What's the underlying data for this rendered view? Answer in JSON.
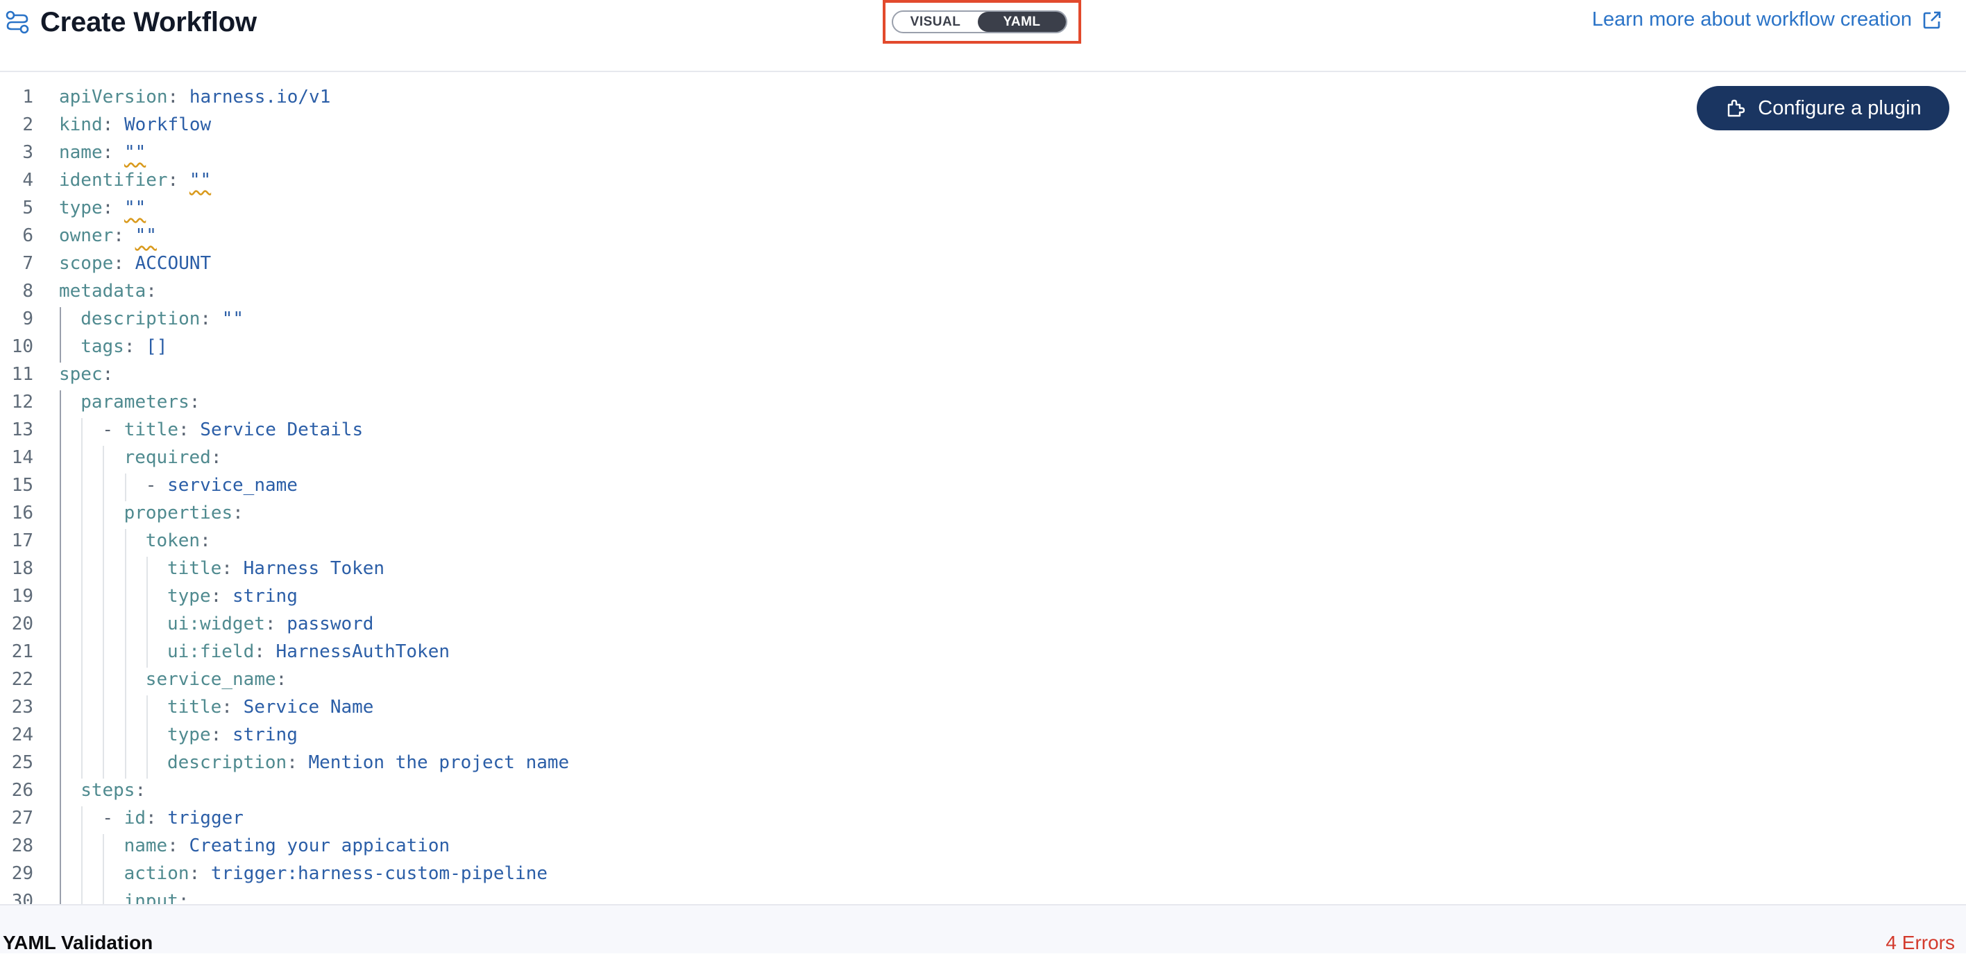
{
  "header": {
    "title": "Create Workflow",
    "toggle": {
      "visual_label": "VISUAL",
      "yaml_label": "YAML",
      "selected": "YAML"
    },
    "learn_more_label": "Learn more about workflow creation"
  },
  "editor": {
    "configure_button_label": "Configure a plugin",
    "lines": [
      {
        "n": "1",
        "indent": 0,
        "key": "apiVersion",
        "value": "harness.io/v1"
      },
      {
        "n": "2",
        "indent": 0,
        "key": "kind",
        "value": "Workflow"
      },
      {
        "n": "3",
        "indent": 0,
        "key": "name",
        "value": "\"\"",
        "error": true
      },
      {
        "n": "4",
        "indent": 0,
        "key": "identifier",
        "value": "\"\"",
        "error": true
      },
      {
        "n": "5",
        "indent": 0,
        "key": "type",
        "value": "\"\"",
        "error": true
      },
      {
        "n": "6",
        "indent": 0,
        "key": "owner",
        "value": "\"\"",
        "error": true
      },
      {
        "n": "7",
        "indent": 0,
        "key": "scope",
        "value": "ACCOUNT"
      },
      {
        "n": "8",
        "indent": 0,
        "key": "metadata",
        "value": ""
      },
      {
        "n": "9",
        "indent": 1,
        "key": "description",
        "value": "\"\""
      },
      {
        "n": "10",
        "indent": 1,
        "key": "tags",
        "value": "[]"
      },
      {
        "n": "11",
        "indent": 0,
        "key": "spec",
        "value": ""
      },
      {
        "n": "12",
        "indent": 1,
        "key": "parameters",
        "value": ""
      },
      {
        "n": "13",
        "indent": 2,
        "dash": true,
        "key": "title",
        "value": "Service Details"
      },
      {
        "n": "14",
        "indent": 3,
        "key": "required",
        "value": ""
      },
      {
        "n": "15",
        "indent": 4,
        "dash": true,
        "key": "",
        "value": "service_name"
      },
      {
        "n": "16",
        "indent": 3,
        "key": "properties",
        "value": ""
      },
      {
        "n": "17",
        "indent": 4,
        "key": "token",
        "value": ""
      },
      {
        "n": "18",
        "indent": 5,
        "key": "title",
        "value": "Harness Token"
      },
      {
        "n": "19",
        "indent": 5,
        "key": "type",
        "value": "string"
      },
      {
        "n": "20",
        "indent": 5,
        "key": "ui:widget",
        "value": "password"
      },
      {
        "n": "21",
        "indent": 5,
        "key": "ui:field",
        "value": "HarnessAuthToken"
      },
      {
        "n": "22",
        "indent": 4,
        "key": "service_name",
        "value": ""
      },
      {
        "n": "23",
        "indent": 5,
        "key": "title",
        "value": "Service Name"
      },
      {
        "n": "24",
        "indent": 5,
        "key": "type",
        "value": "string"
      },
      {
        "n": "25",
        "indent": 5,
        "key": "description",
        "value": "Mention the project name"
      },
      {
        "n": "26",
        "indent": 1,
        "key": "steps",
        "value": ""
      },
      {
        "n": "27",
        "indent": 2,
        "dash": true,
        "key": "id",
        "value": "trigger"
      },
      {
        "n": "28",
        "indent": 3,
        "key": "name",
        "value": "Creating your appication"
      },
      {
        "n": "29",
        "indent": 3,
        "key": "action",
        "value": "trigger:harness-custom-pipeline"
      },
      {
        "n": "30",
        "indent": 3,
        "key": "input",
        "value": ""
      }
    ]
  },
  "validation": {
    "title": "YAML Validation",
    "errors_label": "4 Errors"
  },
  "colors": {
    "accent_link": "#2a73c7",
    "button_bg": "#1a3561",
    "toggle_selected": "#3b3f4a",
    "highlight_border": "#e24a2d",
    "error_text": "#d33a2c",
    "yaml_key": "#4f8a8f",
    "yaml_value": "#2b5ea7"
  }
}
